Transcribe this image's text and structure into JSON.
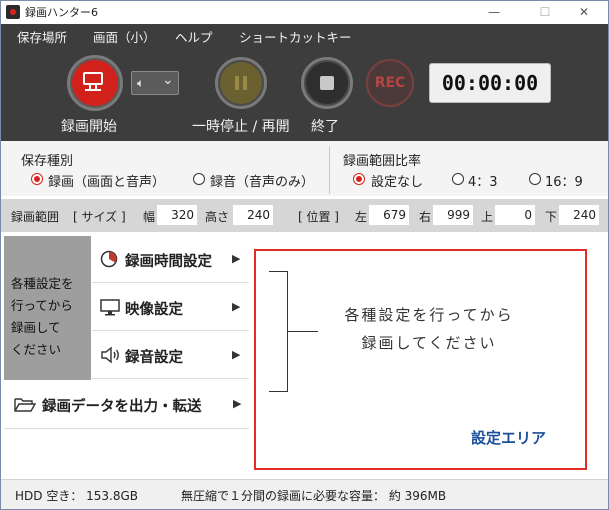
{
  "window": {
    "title": "録画ハンター6",
    "controls": {
      "minimize": "—",
      "maximize": "☐",
      "close": "✕"
    }
  },
  "menu": [
    "保存場所",
    "画面（小）",
    "ヘルプ",
    "ショートカットキー"
  ],
  "toolbar": {
    "record_label": "録画開始",
    "speaker_symbol": "🔈︎",
    "speaker_chevron": "⌄",
    "pause_label": "一時停止 / 再開",
    "stop_label": "終了",
    "rec_text": "REC",
    "timer": "00:00:00"
  },
  "save_type": {
    "label": "保存種別",
    "options": [
      {
        "text": "録画（画面と音声）",
        "selected": true
      },
      {
        "text": "録音（音声のみ）",
        "selected": false
      }
    ]
  },
  "aspect": {
    "label": "録画範囲比率",
    "options": [
      {
        "text": "設定なし",
        "selected": true
      },
      {
        "text": "4：3",
        "selected": false
      },
      {
        "text": "16：9",
        "selected": false
      }
    ]
  },
  "range": {
    "label": "録画範囲",
    "size_label": "[ サイズ ]",
    "width_label": "幅",
    "width": "320",
    "height_label": "高さ",
    "height": "240",
    "pos_label": "[ 位置 ]",
    "left_label": "左",
    "left": "679",
    "right_label": "右",
    "right": "999",
    "top_label": "上",
    "top": "0",
    "bottom_label": "下",
    "bottom": "240"
  },
  "left_menu": {
    "hint": "各種設定を\n行ってから\n録画して\nください",
    "items": [
      {
        "label": "録画時間設定",
        "icon": "clock-pie-icon"
      },
      {
        "label": "映像設定",
        "icon": "monitor-icon"
      },
      {
        "label": "録音設定",
        "icon": "speaker-icon"
      }
    ],
    "export": {
      "label": "録画データを出力・転送",
      "icon": "folder-icon"
    }
  },
  "setting_area": {
    "message": "各種設定を行ってから\n録画してください",
    "caption": "設定エリア"
  },
  "status": {
    "hdd": "HDD 空き： 153.8GB",
    "capacity": "無圧縮で１分間の録画に必要な容量： 約 396MB"
  },
  "colors": {
    "accent_red": "#d2211a",
    "caption_blue": "#1c4f99",
    "dark_bg": "#3d3d3d"
  }
}
